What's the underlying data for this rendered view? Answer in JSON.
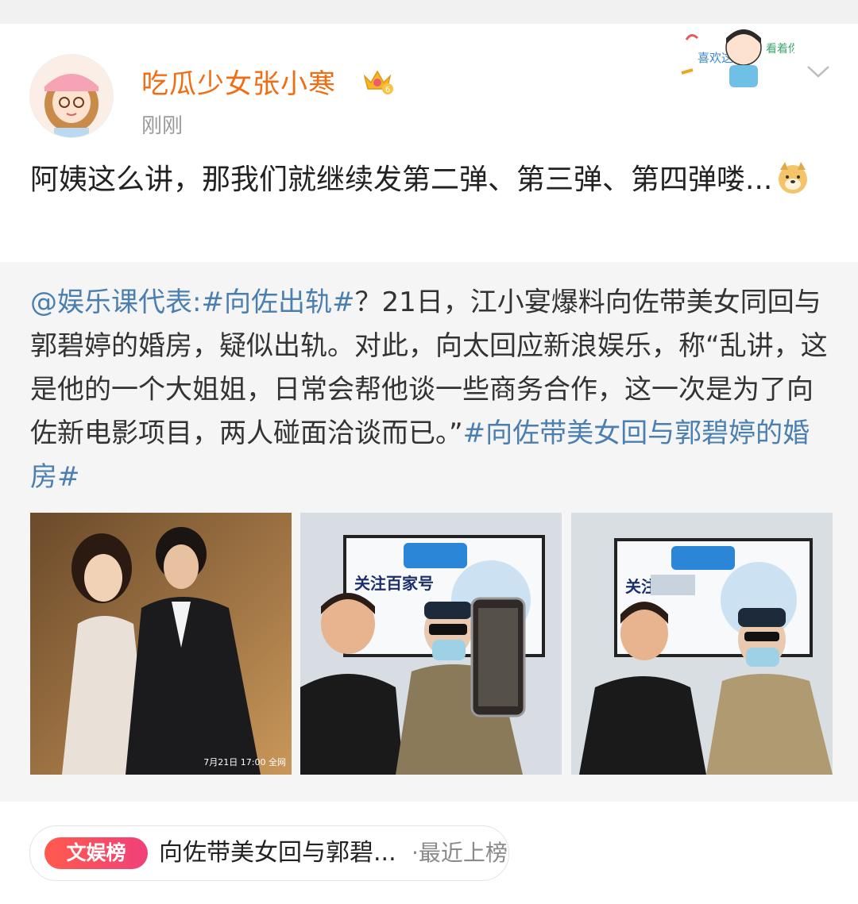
{
  "user": {
    "name": "吃瓜少女张小寒",
    "vip_level": "6",
    "time": "刚刚"
  },
  "sticker": {
    "left_text": "喜欢这样",
    "right_text": "看着你"
  },
  "post": {
    "text": "阿姨这么讲，那我们就继续发第二弹、第三弹、第四弹喽..."
  },
  "repost": {
    "mention": "@娱乐课代表",
    "colon": ":",
    "hashtag1": "#向佐出轨#",
    "body": "？21日，江小宴爆料向佐带美女同回与郭碧婷的婚房，疑似出轨。对此，向太回应新浪娱乐，称“乱讲，这是他的一个大姐姐，日常会帮他谈一些商务合作，这一次是为了向佐新电影项目，两人碰面洽谈而已。”",
    "hashtag2": "#向佐带美女回与郭碧婷的婚房#"
  },
  "images": {
    "img1_stamp": "7月21日 17:00 全网",
    "img2_screen_text": "关注百家号",
    "img3_screen_text": "关注"
  },
  "trend": {
    "badge": "文娱榜",
    "title": "向佐带美女回与郭碧...",
    "meta": "·最近上榜"
  },
  "colors": {
    "username": "#f26d12",
    "link": "#4a7fb0",
    "trend_badge_start": "#ff5a4e",
    "trend_badge_end": "#f0407a"
  }
}
